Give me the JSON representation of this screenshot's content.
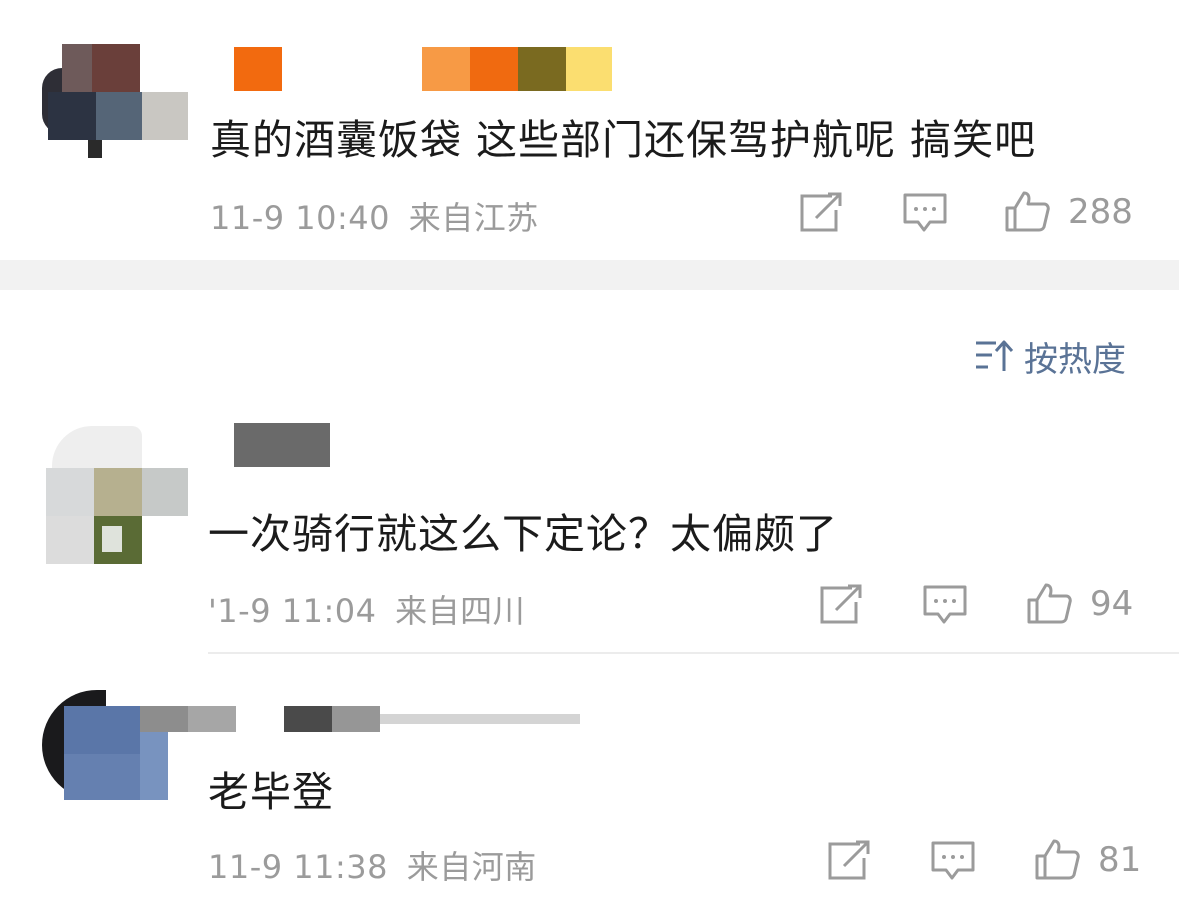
{
  "sort": {
    "label": "按热度"
  },
  "colors": {
    "text": "#1b1b1b",
    "meta": "#9b9b9b",
    "sort": "#5a7396",
    "band": "#f2f2f2"
  },
  "comments": [
    {
      "text": "真的酒囊饭袋 这些部门还保驾护航呢 搞笑吧",
      "time": "11-9 10:40",
      "location": "来自江苏",
      "likes": "288",
      "icons": [
        "share-icon",
        "comment-icon",
        "like-icon"
      ]
    },
    {
      "text": "一次骑行就这么下定论？太偏颇了",
      "time": "'1-9 11:04",
      "location": "来自四川",
      "likes": "94",
      "icons": [
        "share-icon",
        "comment-icon",
        "like-icon"
      ]
    },
    {
      "text": "老毕登",
      "time": "11-9 11:38",
      "location": "来自河南",
      "likes": "81",
      "icons": [
        "share-icon",
        "comment-icon",
        "like-icon"
      ]
    }
  ]
}
